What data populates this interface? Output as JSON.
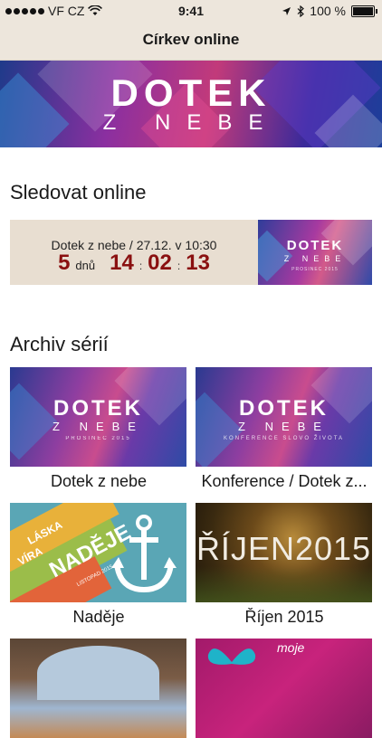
{
  "status_bar": {
    "carrier": "VF CZ",
    "time": "9:41",
    "battery": "100 %",
    "icons": [
      "signal-dots",
      "wifi-icon",
      "location-arrow-icon",
      "bluetooth-icon",
      "battery-icon"
    ]
  },
  "nav": {
    "title": "Církev online"
  },
  "banner": {
    "line1": "DOTEK",
    "line2": "Z NEBE"
  },
  "live": {
    "section_title": "Sledovat online",
    "event": "Dotek z nebe / 27.12. v 10:30",
    "days": "5",
    "days_unit": "dnů",
    "hours": "14",
    "minutes": "02",
    "seconds": "13",
    "separator": ":",
    "thumb_line1": "DOTEK",
    "thumb_line2": "Z NEBE",
    "thumb_line3": "PROSINEC 2015",
    "accent_color": "#8a1010"
  },
  "archive": {
    "section_title": "Archiv sérií",
    "items": [
      {
        "label": "Dotek z nebe",
        "art_line1": "DOTEK",
        "art_line2": "Z NEBE",
        "art_line3": "PROSINEC 2015"
      },
      {
        "label": "Konference / Dotek z...",
        "art_line1": "DOTEK",
        "art_line2": "Z NEBE",
        "art_line3": "KONFERENCE SLOVO ŽIVOTA"
      },
      {
        "label": "Naděje",
        "art_words": [
          "LÁSKA",
          "VÍRA",
          "NADĚJE"
        ],
        "art_sub": "LISTOPAD 2015"
      },
      {
        "label": "Říjen 2015",
        "art_title": "ŘÍJEN2015"
      },
      {
        "label": "",
        "art_title": ""
      },
      {
        "label": "",
        "art_line1": "moje"
      }
    ]
  }
}
